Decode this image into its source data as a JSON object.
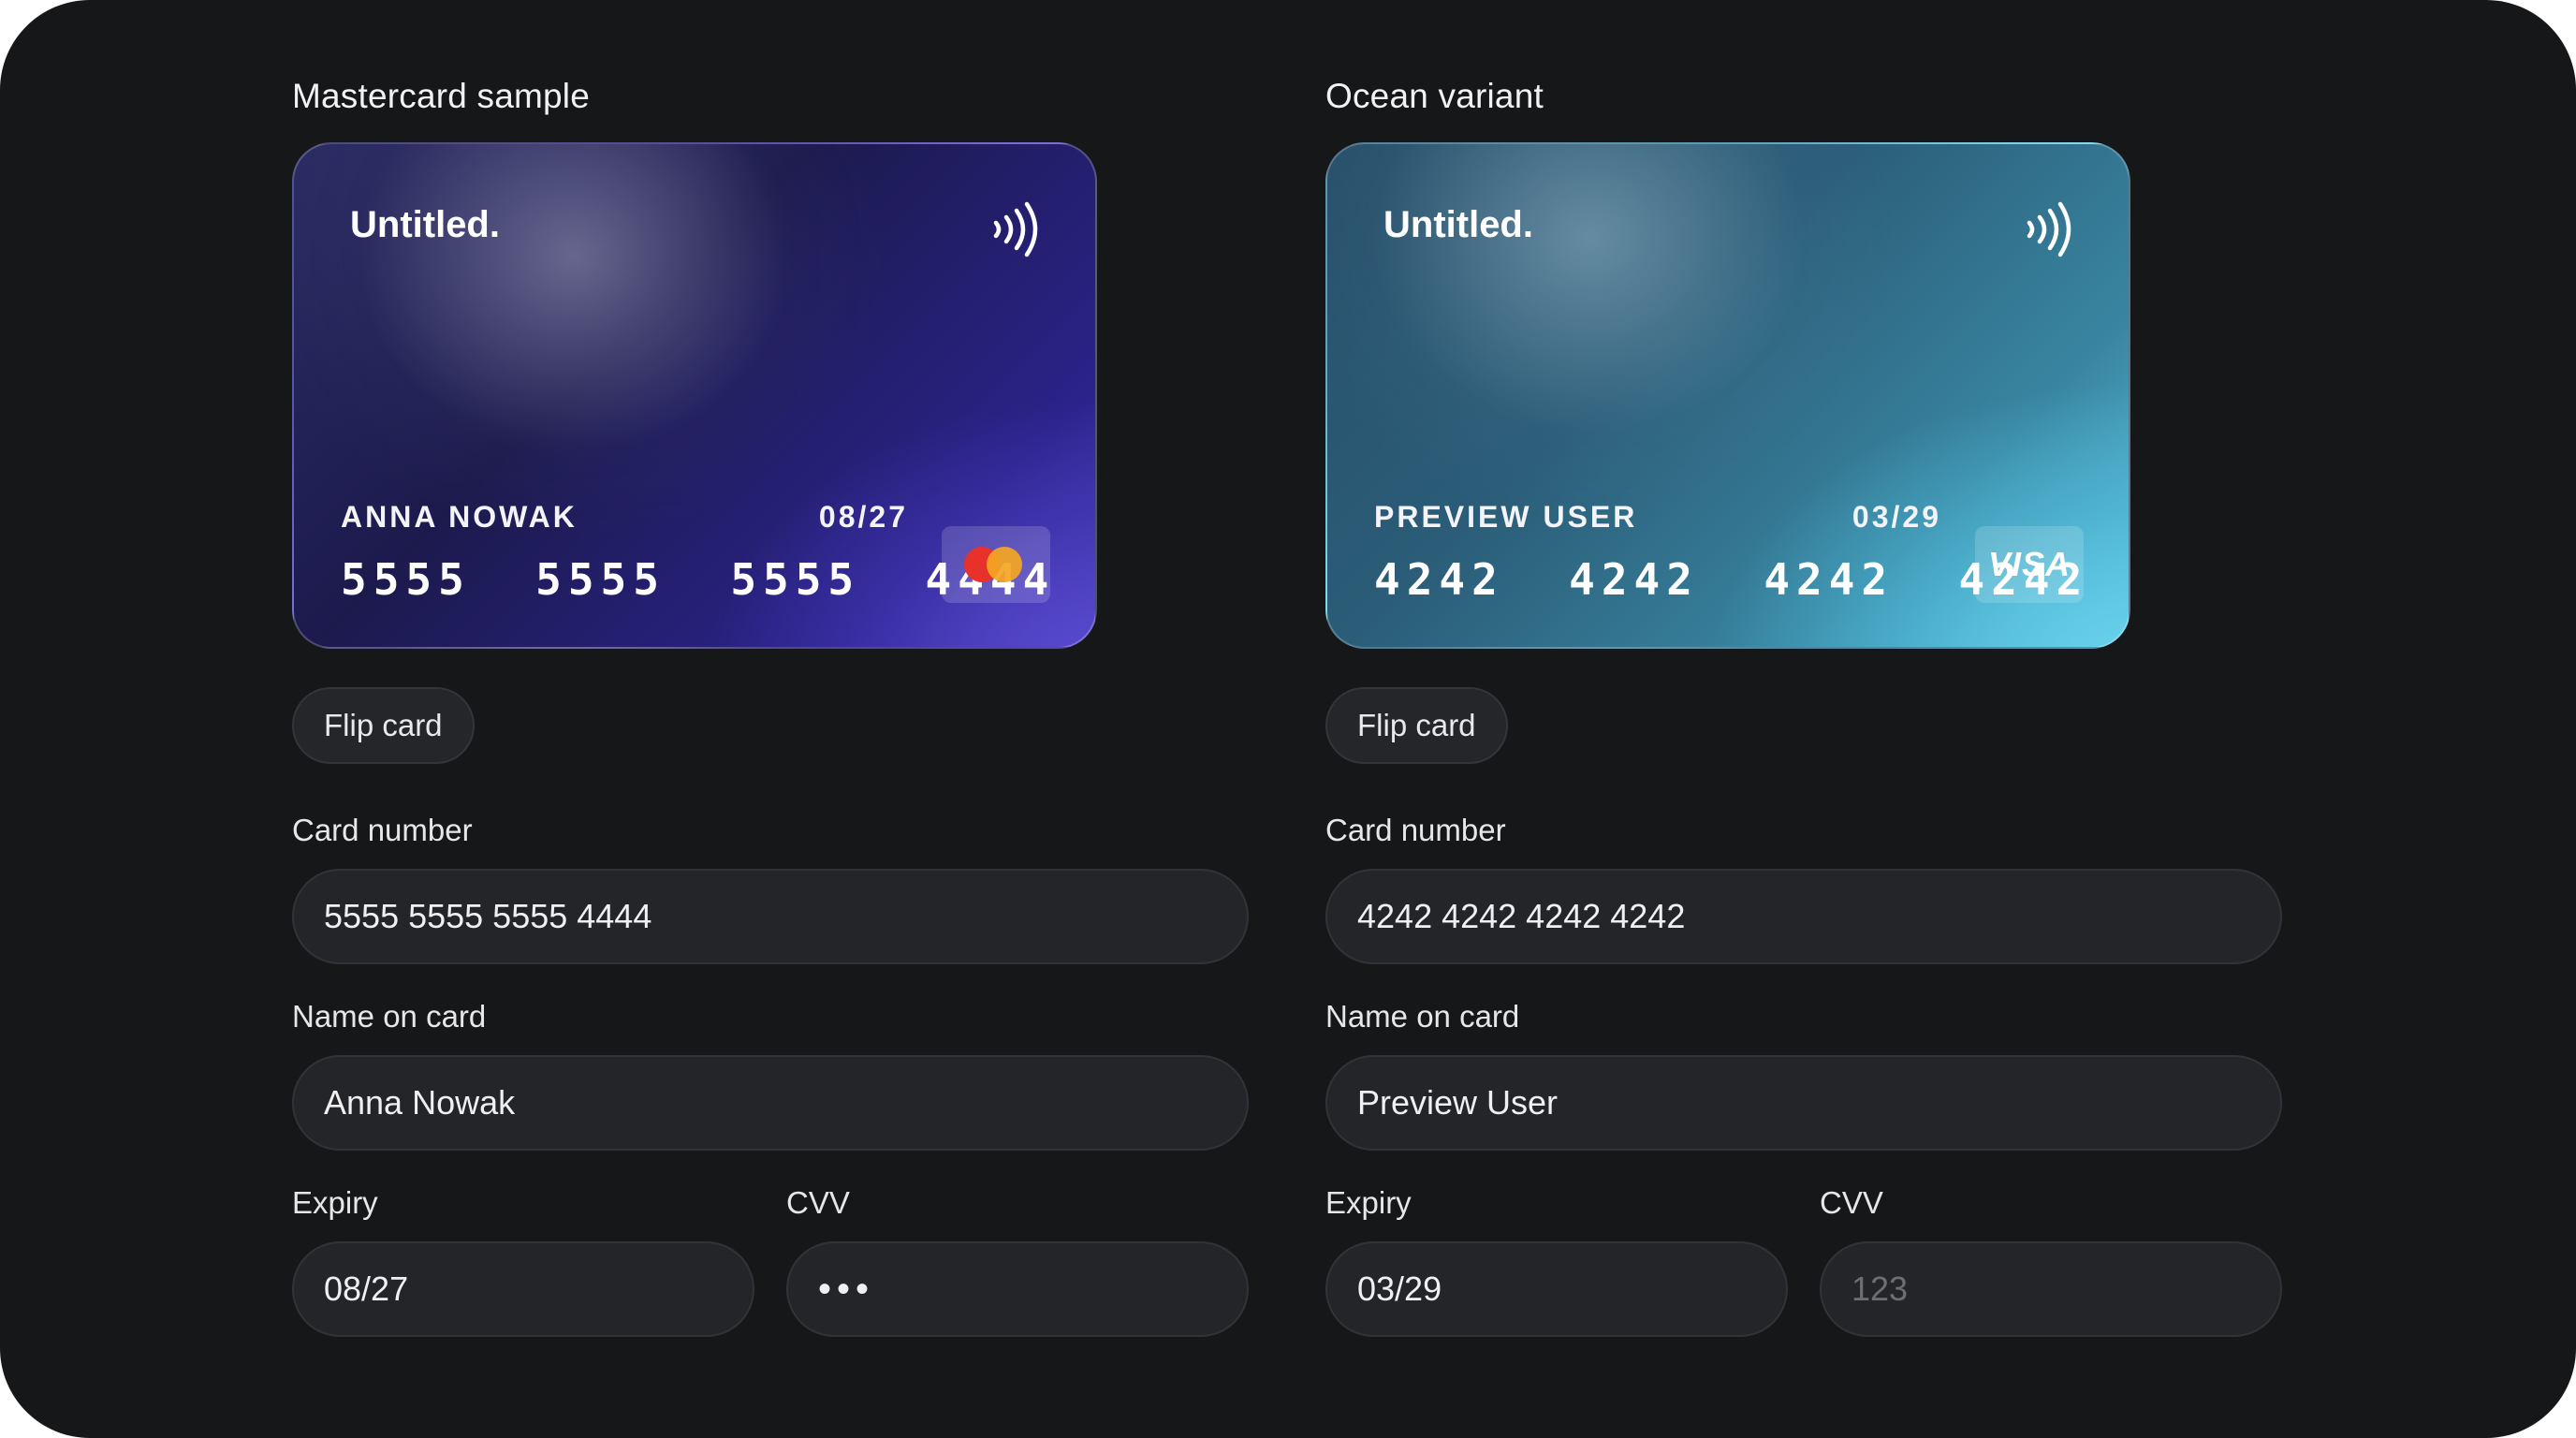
{
  "panels": [
    {
      "title": "Mastercard sample",
      "card": {
        "brand": "Untitled.",
        "holder": "ANNA NOWAK",
        "expiry": "08/27",
        "number": "5555  5555  5555  4444",
        "network_icon": "mastercard-logo",
        "theme_colors": [
          "#1c1a4d",
          "#2a238a",
          "#5a4bd0"
        ]
      },
      "flip_label": "Flip card",
      "form": {
        "number_label": "Card number",
        "number_value": "5555 5555 5555 4444",
        "name_label": "Name on card",
        "name_value": "Anna Nowak",
        "expiry_label": "Expiry",
        "expiry_value": "08/27",
        "cvv_label": "CVV",
        "cvv_value": "•••"
      }
    },
    {
      "title": "Ocean variant",
      "card": {
        "brand": "Untitled.",
        "holder": "PREVIEW USER",
        "expiry": "03/29",
        "number": "4242  4242  4242  4242",
        "network_label": "VISA",
        "network_icon": "visa-logo",
        "theme_colors": [
          "#274f69",
          "#3986a2",
          "#6ad2ec"
        ]
      },
      "flip_label": "Flip card",
      "form": {
        "number_label": "Card number",
        "number_value": "4242 4242 4242 4242",
        "name_label": "Name on card",
        "name_value": "Preview User",
        "expiry_label": "Expiry",
        "expiry_value": "03/29",
        "cvv_label": "CVV",
        "cvv_placeholder": "123"
      }
    }
  ],
  "icons": {
    "contactless": "contactless-icon"
  },
  "colors": {
    "background": "#161719",
    "input_background": "#242528",
    "mastercard_red": "#e8312a",
    "mastercard_orange": "#f5a623"
  }
}
